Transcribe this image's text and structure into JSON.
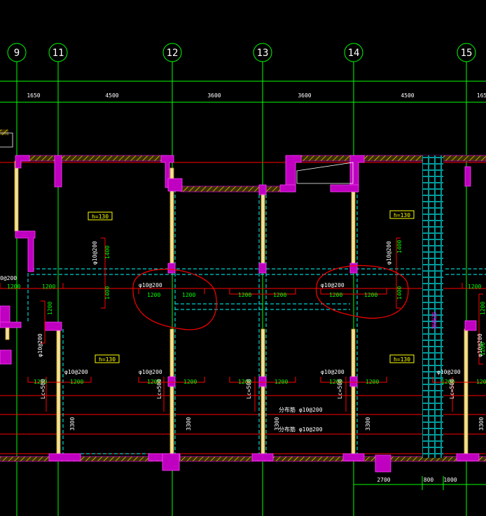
{
  "axes": [
    "9",
    "11",
    "12",
    "13",
    "14",
    "15"
  ],
  "top_dims": [
    "1650",
    "4500",
    "3600",
    "3600",
    "4500",
    "165"
  ],
  "bottom_dims": [
    "2700",
    "800",
    "1000"
  ],
  "slab_tags": [
    "h=130",
    "h=130",
    "h=130",
    "h=130"
  ],
  "rebar": {
    "phi10_200": "φ10@200",
    "phi10_200_left_edge": "0@200",
    "top_edge_note": "分布筋 φ10@200",
    "bottom_edge_note": "分布筋 φ10@200"
  },
  "lengths": {
    "l1200": "1200",
    "l1400": "1400",
    "l3300": "3300",
    "lc500": "Lc=500"
  },
  "shaft_label": "风道井",
  "colors": {
    "axis": "#00ff00",
    "wall": "#c8a000",
    "column": "#c000c0",
    "dim": "#00ff00",
    "text_white": "#ffffff",
    "text_yellow": "#ffff00",
    "red": "#ff0000",
    "cyan": "#00ffff",
    "magenta": "#ff00ff"
  }
}
